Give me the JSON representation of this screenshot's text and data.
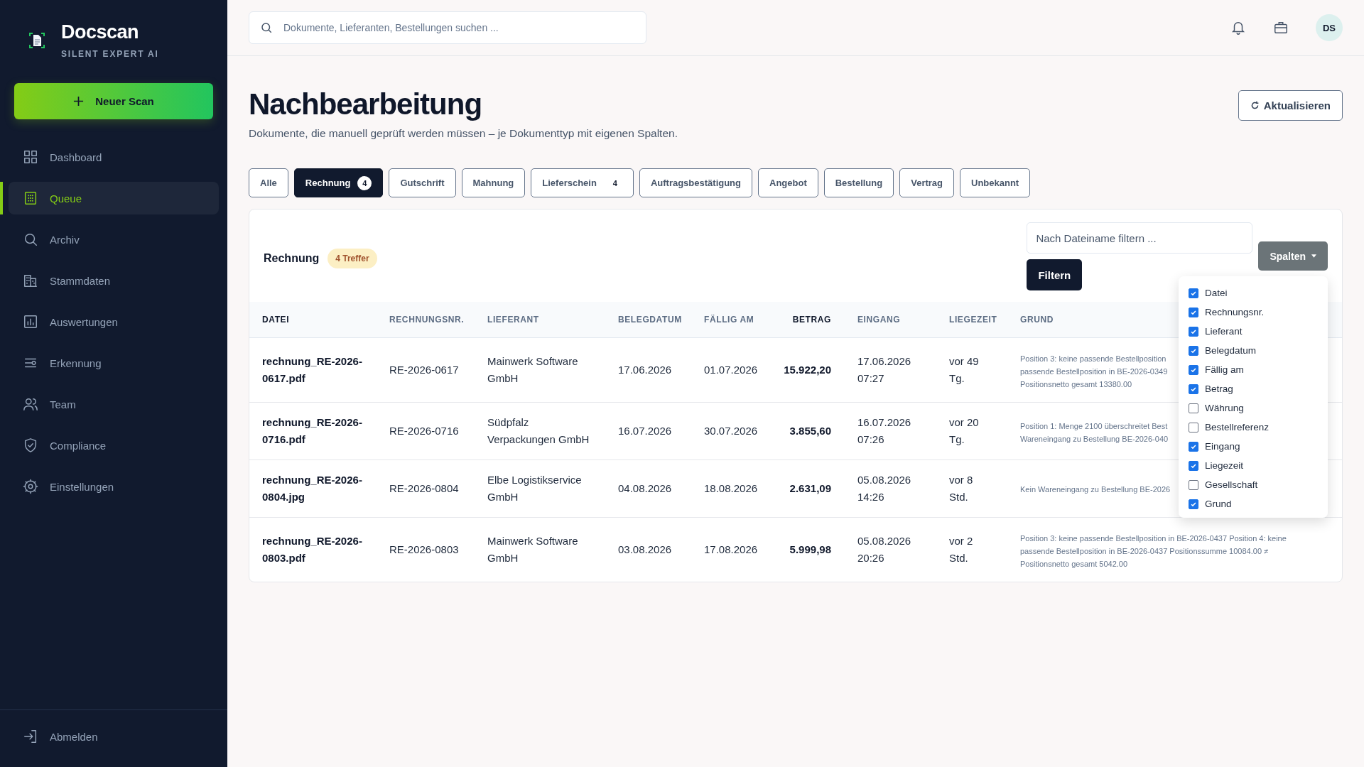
{
  "sidebar": {
    "brand": {
      "name": "Docscan",
      "tagline": "SILENT EXPERT AI"
    },
    "new_scan_button": "Neuer Scan",
    "items": [
      {
        "label": "Dashboard",
        "selected": false
      },
      {
        "label": "Queue",
        "selected": true
      },
      {
        "label": "Archiv",
        "selected": false
      },
      {
        "label": "Stammdaten",
        "selected": false
      },
      {
        "label": "Auswertungen",
        "selected": false
      },
      {
        "label": "Erkennung",
        "selected": false
      },
      {
        "label": "Team",
        "selected": false
      },
      {
        "label": "Compliance",
        "selected": false
      },
      {
        "label": "Einstellungen",
        "selected": false
      }
    ],
    "logout": "Abmelden"
  },
  "topbar": {
    "search": {
      "placeholder": "Dokumente, Lieferanten, Bestellungen suchen ..."
    },
    "avatar": "DS"
  },
  "page": {
    "title": "Nachbearbeitung",
    "subtitle": "Dokumente, die manuell geprüft werden müssen – je Dokumenttyp mit eigenen Spalten.",
    "refresh_button": "Aktualisieren"
  },
  "tabs": [
    {
      "label": "Alle",
      "selected": false
    },
    {
      "label": "Rechnung",
      "count": "4",
      "selected": true
    },
    {
      "label": "Gutschrift",
      "selected": false
    },
    {
      "label": "Mahnung",
      "selected": false
    },
    {
      "label": "Lieferschein",
      "count": "4",
      "selected": false
    },
    {
      "label": "Auftragsbestätigung",
      "selected": false
    },
    {
      "label": "Angebot",
      "selected": false
    },
    {
      "label": "Bestellung",
      "selected": false
    },
    {
      "label": "Vertrag",
      "selected": false
    },
    {
      "label": "Unbekannt",
      "selected": false
    }
  ],
  "panel": {
    "title": "Rechnung",
    "badge": "4 Treffer",
    "filter": {
      "placeholder": "Nach Dateiname filtern ..."
    },
    "filter_button": "Filtern",
    "columns_button": "Spalten",
    "column_menu": [
      {
        "label": "Datei",
        "checked": true
      },
      {
        "label": "Rechnungsnr.",
        "checked": true
      },
      {
        "label": "Lieferant",
        "checked": true
      },
      {
        "label": "Belegdatum",
        "checked": true
      },
      {
        "label": "Fällig am",
        "checked": true
      },
      {
        "label": "Betrag",
        "checked": true
      },
      {
        "label": "Währung",
        "checked": false
      },
      {
        "label": "Bestellreferenz",
        "checked": false
      },
      {
        "label": "Eingang",
        "checked": true
      },
      {
        "label": "Liegezeit",
        "checked": true
      },
      {
        "label": "Gesellschaft",
        "checked": false
      },
      {
        "label": "Grund",
        "checked": true
      }
    ],
    "table": {
      "columns": [
        "DATEI",
        "RECHNUNGSNR.",
        "LIEFERANT",
        "BELEGDATUM",
        "FÄLLIG AM",
        "BETRAG",
        "EINGANG",
        "LIEGEZEIT",
        "GRUND"
      ],
      "rows": [
        {
          "datei": "rechnung_RE-2026-0617.pdf",
          "rechnungsnr": "RE-2026-0617",
          "lieferant": "Mainwerk Software GmbH",
          "belegdatum": "17.06.2026",
          "faellig": "01.07.2026",
          "betrag": "15.922,20",
          "eingang": "17.06.2026 07:27",
          "liegezeit": "vor 49 Tg.",
          "grund": [
            "Position 3: keine passende Bestellposition",
            "passende Bestellposition in BE-2026-0349",
            "Positionsnetto gesamt 13380.00"
          ]
        },
        {
          "datei": "rechnung_RE-2026-0716.pdf",
          "rechnungsnr": "RE-2026-0716",
          "lieferant": "Südpfalz Verpackungen GmbH",
          "belegdatum": "16.07.2026",
          "faellig": "30.07.2026",
          "betrag": "3.855,60",
          "eingang": "16.07.2026 07:26",
          "liegezeit": "vor 20 Tg.",
          "grund": [
            "Position 1: Menge 2100 überschreitet Best",
            "Wareneingang zu Bestellung BE-2026-040"
          ]
        },
        {
          "datei": "rechnung_RE-2026-0804.jpg",
          "rechnungsnr": "RE-2026-0804",
          "lieferant": "Elbe Logistikservice GmbH",
          "belegdatum": "04.08.2026",
          "faellig": "18.08.2026",
          "betrag": "2.631,09",
          "eingang": "05.08.2026 14:26",
          "liegezeit": "vor 8 Std.",
          "grund": [
            "Kein Wareneingang zu Bestellung BE-2026"
          ]
        },
        {
          "datei": "rechnung_RE-2026-0803.pdf",
          "rechnungsnr": "RE-2026-0803",
          "lieferant": "Mainwerk Software GmbH",
          "belegdatum": "03.08.2026",
          "faellig": "17.08.2026",
          "betrag": "5.999,98",
          "eingang": "05.08.2026 20:26",
          "liegezeit": "vor 2 Std.",
          "grund": [
            "Position 3: keine passende Bestellposition in BE-2026-0437 Position 4: keine",
            "passende Bestellposition in BE-2026-0437 Positionssumme 10084.00 ≠",
            "Positionsnetto gesamt 5042.00"
          ]
        }
      ]
    }
  }
}
